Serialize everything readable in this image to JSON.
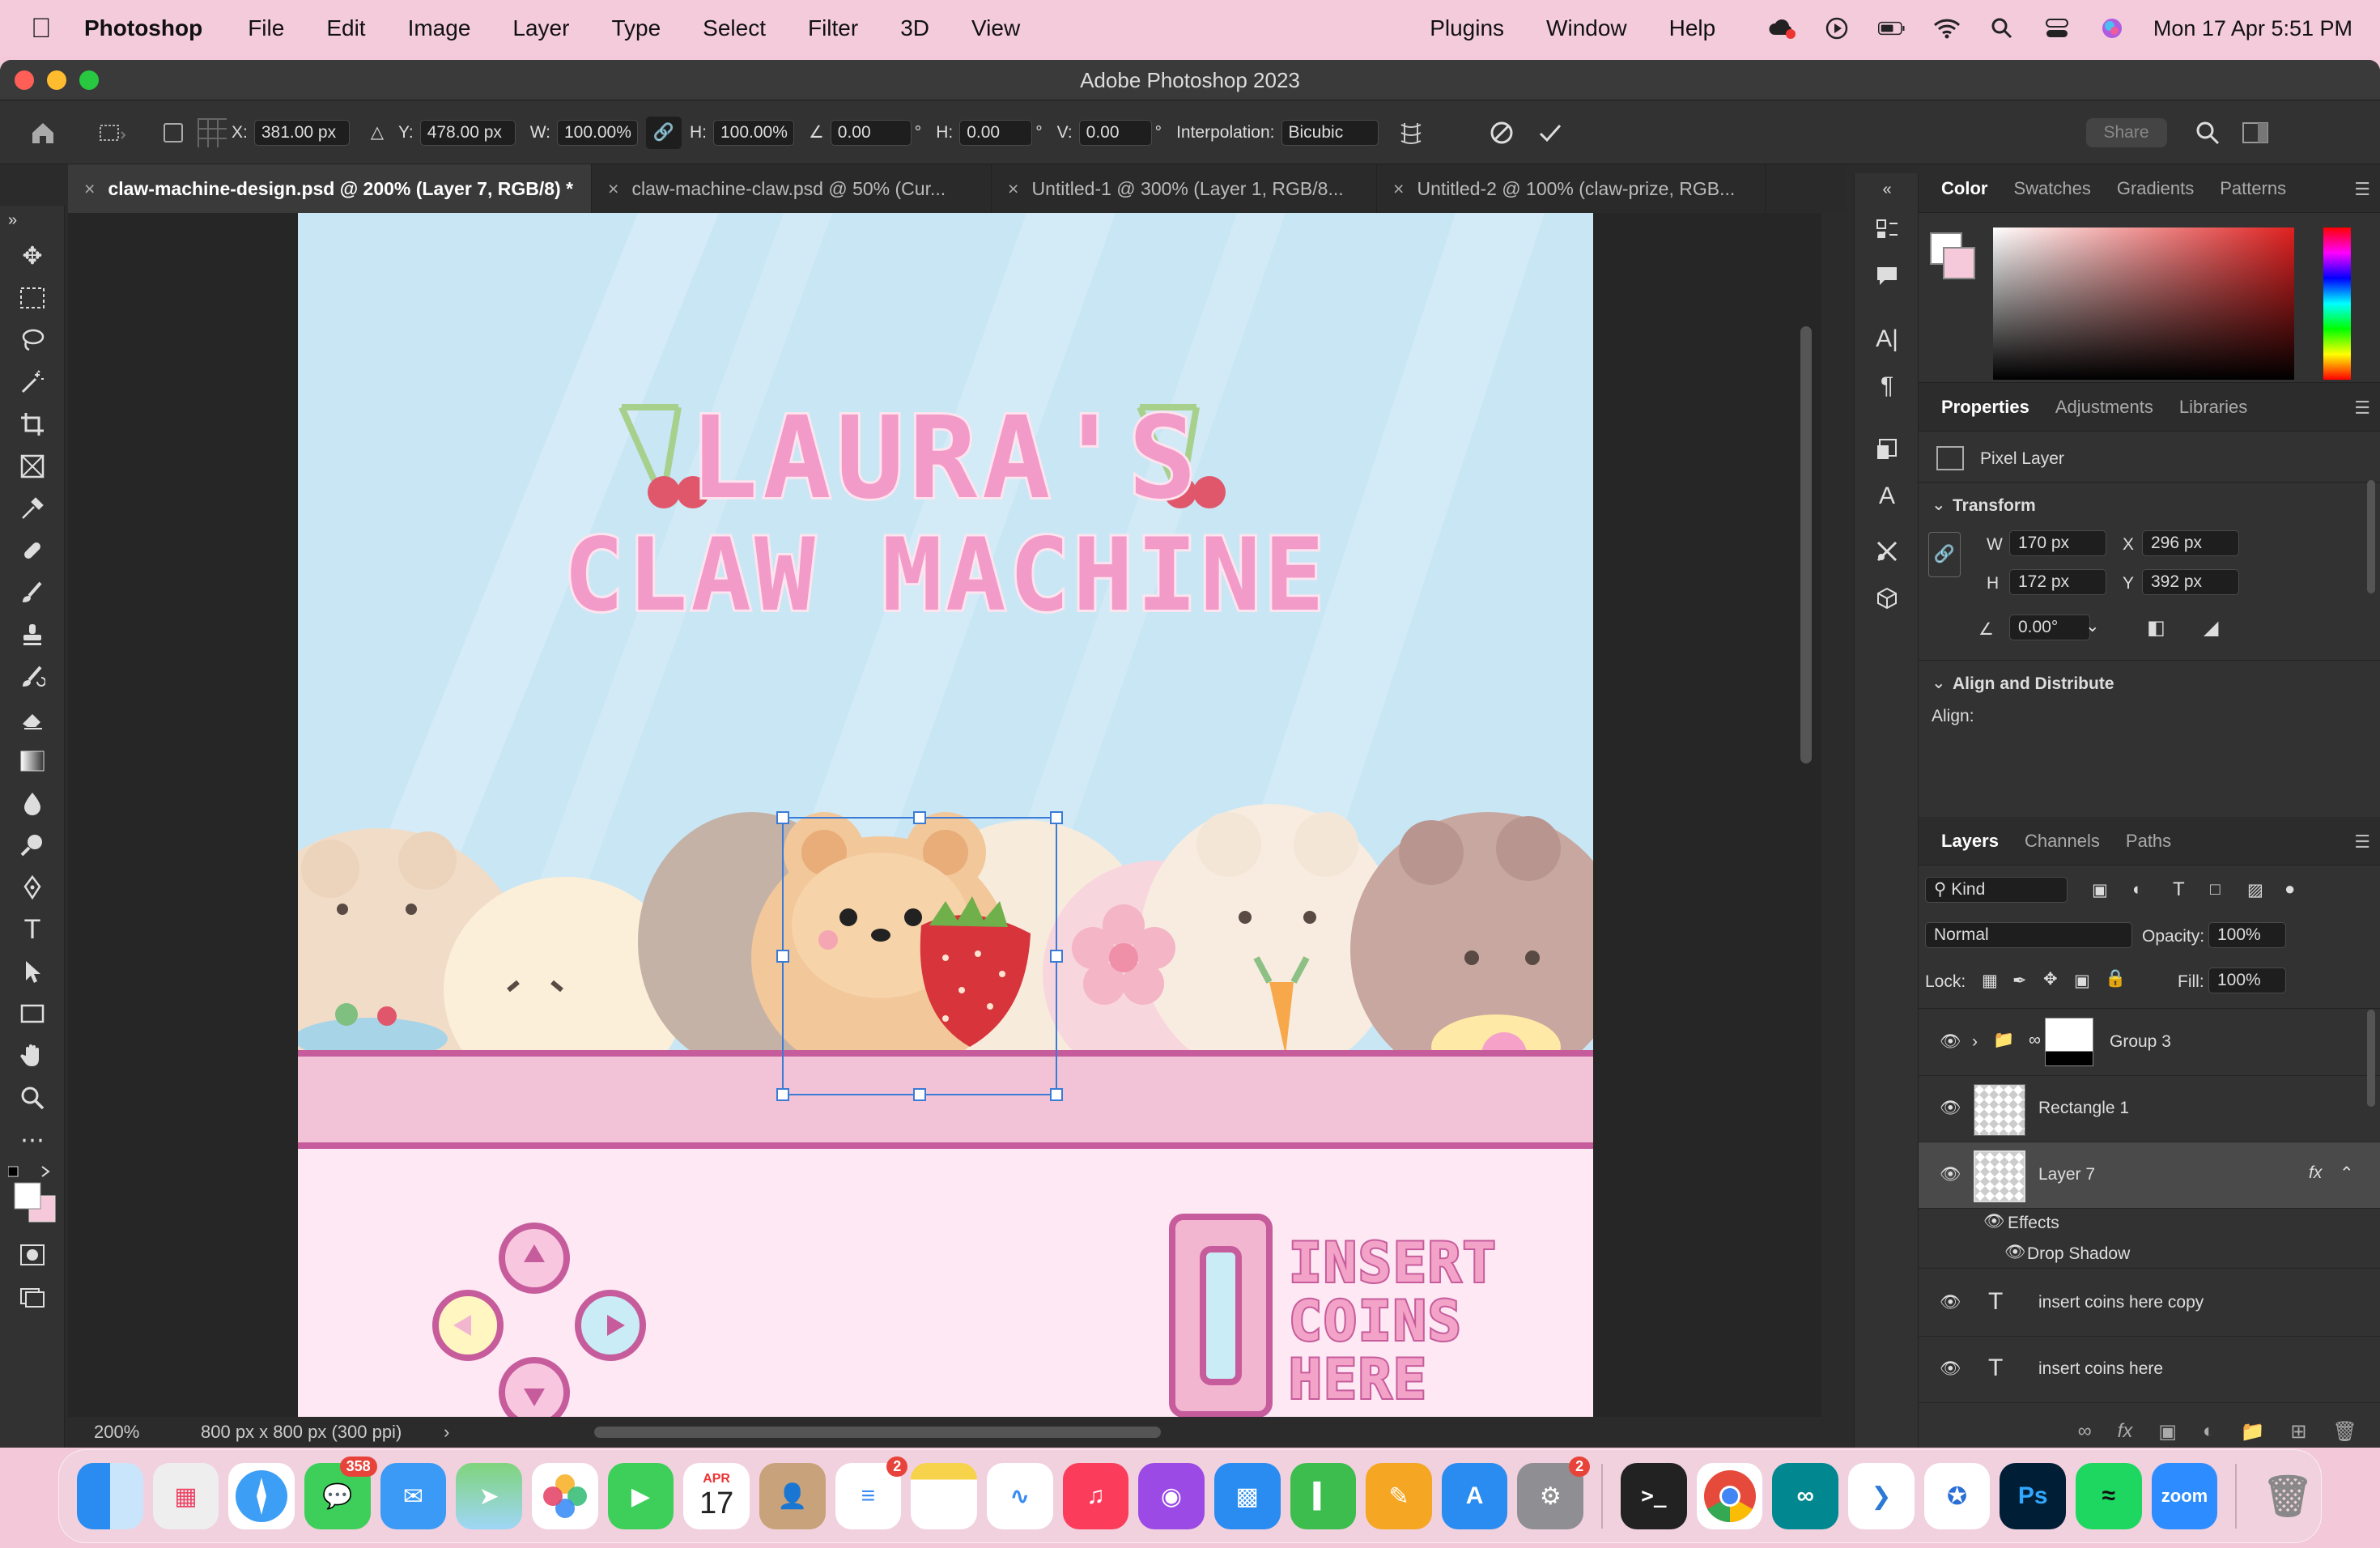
{
  "menubar": {
    "app_name": "Photoshop",
    "items": [
      "File",
      "Edit",
      "Image",
      "Layer",
      "Type",
      "Select",
      "Filter",
      "3D",
      "View",
      "Plugins",
      "Window",
      "Help"
    ],
    "clock": "Mon 17 Apr  5:51 PM"
  },
  "window": {
    "title": "Adobe Photoshop 2023"
  },
  "options_bar": {
    "x_label": "X:",
    "x_value": "381.00 px",
    "y_label": "Y:",
    "y_value": "478.00 px",
    "w_label": "W:",
    "w_value": "100.00%",
    "h_label": "H:",
    "h_value": "100.00%",
    "angle_value": "0.00",
    "hskew_label": "H:",
    "hskew_value": "0.00",
    "vskew_label": "V:",
    "vskew_value": "0.00",
    "interp_label": "Interpolation:",
    "interp_value": "Bicubic",
    "share_label": "Share"
  },
  "doc_tabs": [
    {
      "label": "claw-machine-design.psd @ 200% (Layer 7, RGB/8) *"
    },
    {
      "label": "claw-machine-claw.psd @ 50% (Cur..."
    },
    {
      "label": "Untitled-1 @ 300% (Layer 1, RGB/8..."
    },
    {
      "label": "Untitled-2 @ 100% (claw-prize, RGB..."
    }
  ],
  "artwork": {
    "title_line1": "LAURA'S",
    "title_line2": "CLAW MACHINE",
    "coin_text_1": "INSERT",
    "coin_text_2": "COINS",
    "coin_text_3": "HERE"
  },
  "status": {
    "zoom": "200%",
    "doc_size": "800 px x 800 px (300 ppi)"
  },
  "color_panel": {
    "tabs": [
      "Color",
      "Swatches",
      "Gradients",
      "Patterns"
    ]
  },
  "properties_panel": {
    "tabs": [
      "Properties",
      "Adjustments",
      "Libraries"
    ],
    "layer_kind": "Pixel Layer",
    "transform_label": "Transform",
    "w_label": "W",
    "w_value": "170 px",
    "x_label": "X",
    "x_value": "296 px",
    "h_label": "H",
    "h_value": "172 px",
    "y_label": "Y",
    "y_value": "392 px",
    "angle_value": "0.00°",
    "align_label": "Align and Distribute",
    "align_sub": "Align:"
  },
  "layers_panel": {
    "tabs": [
      "Layers",
      "Channels",
      "Paths"
    ],
    "filter_kind": "Kind",
    "blend_mode": "Normal",
    "opacity_label": "Opacity:",
    "opacity_value": "100%",
    "lock_label": "Lock:",
    "fill_label": "Fill:",
    "fill_value": "100%",
    "layers": [
      {
        "name": "Group 3"
      },
      {
        "name": "Rectangle 1"
      },
      {
        "name": "Layer 7"
      },
      {
        "name": "insert coins here copy"
      },
      {
        "name": "insert coins here"
      }
    ],
    "effects_label": "Effects",
    "drop_shadow_label": "Drop Shadow",
    "fx_label": "fx"
  },
  "dock": {
    "messages_badge": "358",
    "reminders_badge": "2",
    "settings_badge": "2",
    "calendar_month": "APR",
    "calendar_day": "17",
    "ps_label": "Ps",
    "zoom_label": "zoom"
  },
  "colors": {
    "sky": "#c9e6f5",
    "pink_title": "#f29bc8",
    "pink_strip": "#f2c3d6",
    "machine_bg": "#fde8f3",
    "selection": "#3a7bd5"
  }
}
